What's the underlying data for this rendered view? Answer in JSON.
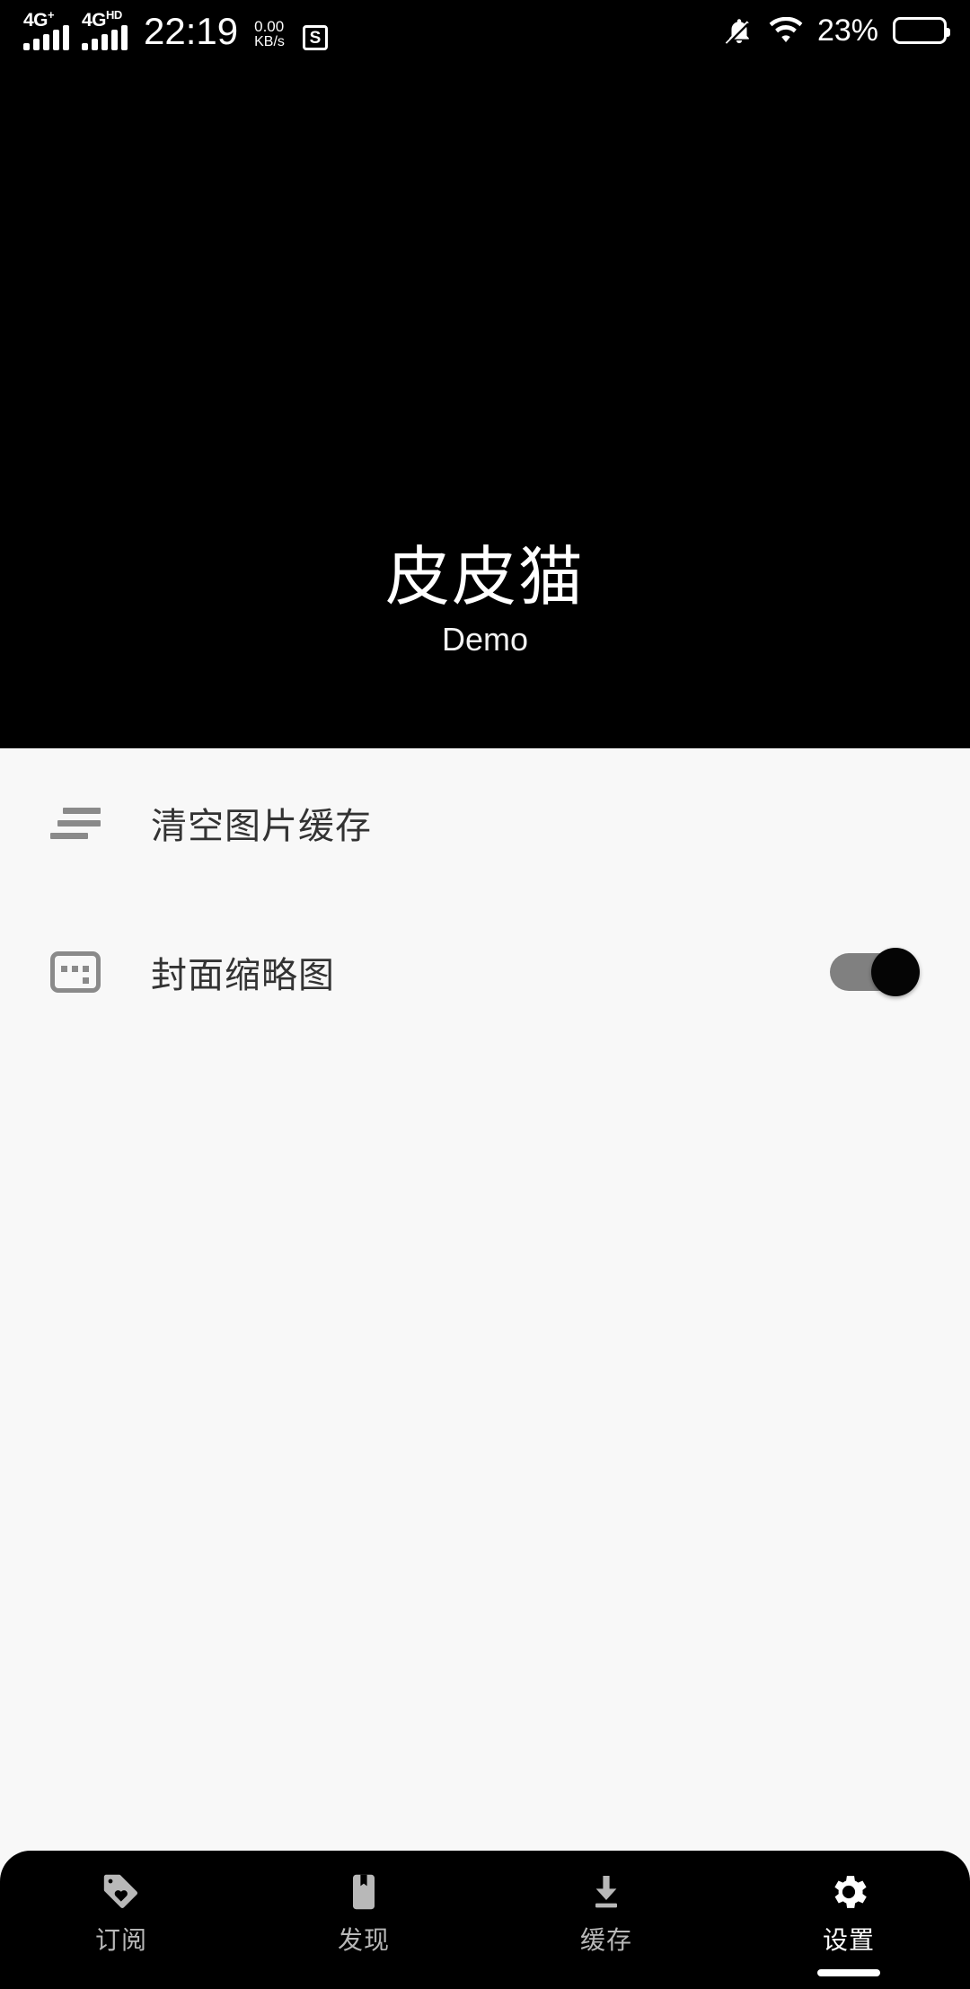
{
  "status_bar": {
    "network_primary": "4G",
    "network_primary_sup": "+",
    "network_secondary": "4G",
    "network_secondary_sup": "HD",
    "time": "22:19",
    "net_speed_value": "0.00",
    "net_speed_unit": "KB/s",
    "app_badge_letter": "S",
    "mute_icon": "bell-muted-icon",
    "wifi_icon": "wifi-icon",
    "battery_percent": "23%",
    "battery_icon": "battery-icon",
    "battery_level": 23
  },
  "header": {
    "title": "皮皮猫",
    "subtitle": "Demo",
    "background_color": "#000000"
  },
  "settings_list": {
    "items": [
      {
        "label": "清空图片缓存",
        "icon": "sort-lines-icon",
        "control": "none"
      },
      {
        "label": "封面缩略图",
        "icon": "thumbnail-icon",
        "control": "switch",
        "switch_on": true
      }
    ]
  },
  "bottom_nav": {
    "items": [
      {
        "label": "订阅",
        "icon": "tag-heart-icon",
        "active": false
      },
      {
        "label": "发现",
        "icon": "bookmark-icon",
        "active": false
      },
      {
        "label": "缓存",
        "icon": "download-icon",
        "active": false
      },
      {
        "label": "设置",
        "icon": "gear-icon",
        "active": true
      }
    ],
    "active_index": 3,
    "background_color": "#000000",
    "inactive_color": "#b8b8b8",
    "active_color": "#ffffff"
  },
  "colors": {
    "content_background": "#f8f8f8",
    "icon_gray": "#8a8a8a",
    "text_primary": "#333333",
    "switch_track_on": "#808080",
    "switch_thumb_on": "#050505"
  }
}
